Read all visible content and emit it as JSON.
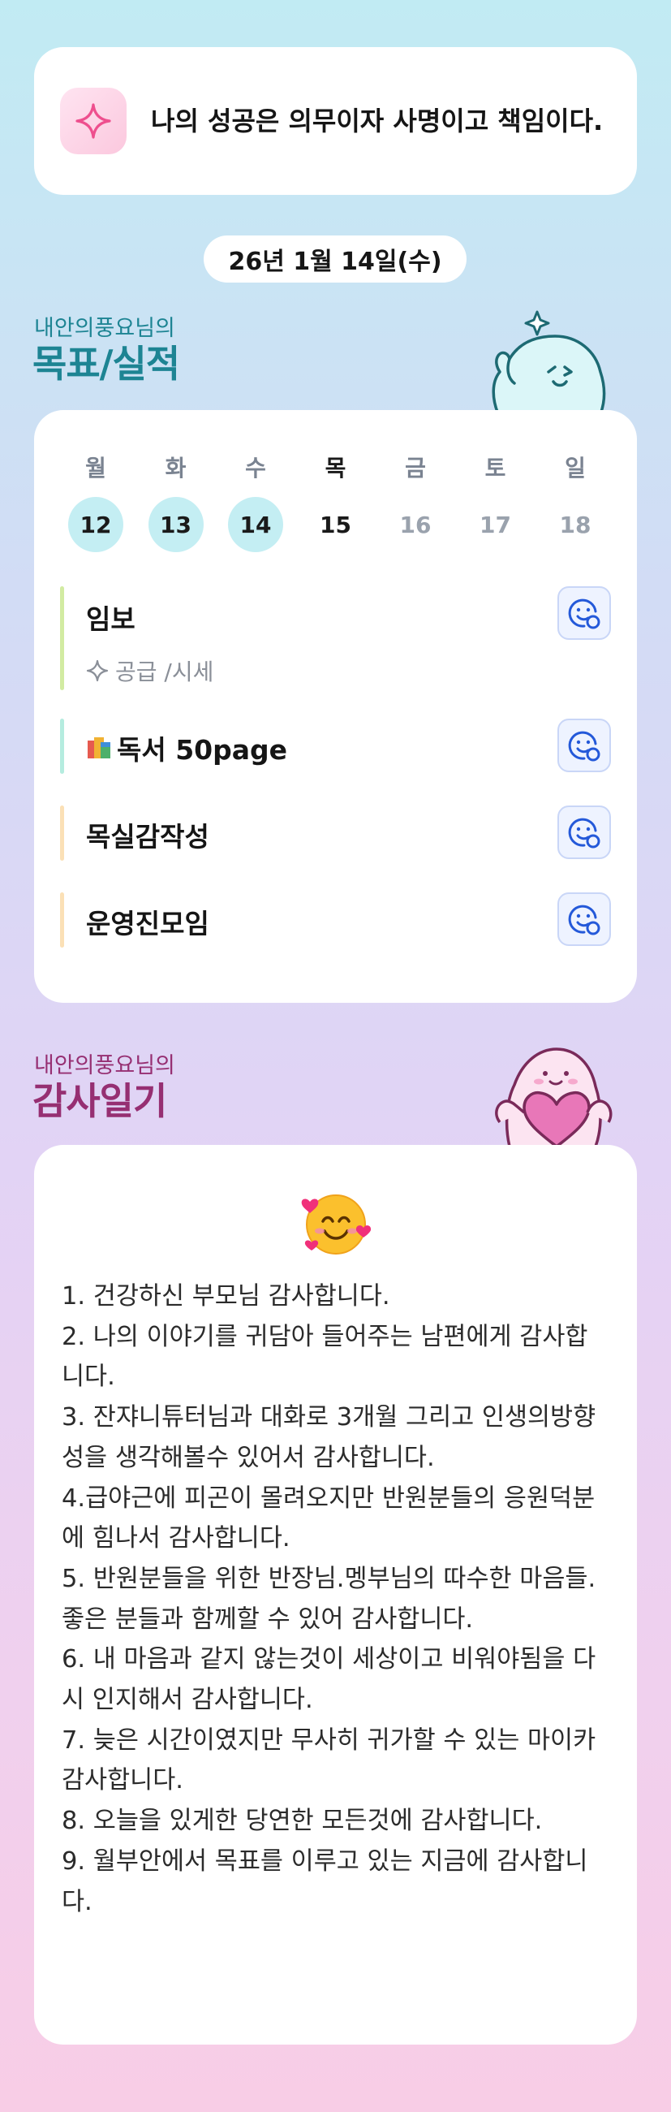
{
  "motto": {
    "text": "나의 성공은 의무이자 사명이고 책임이다.",
    "icon": "sparkle-icon"
  },
  "date": "26년 1월 14일(수)",
  "goals_section": {
    "subtitle": "내안의풍요님의",
    "title": "목표/실적",
    "accent": "#1d8493",
    "week": {
      "days": [
        "월",
        "화",
        "수",
        "목",
        "금",
        "토",
        "일"
      ],
      "dates": [
        "12",
        "13",
        "14",
        "15",
        "16",
        "17",
        "18"
      ]
    },
    "items": [
      {
        "title": "임보",
        "subtitle": "공급 /시세",
        "bar_color": "#d2eba2"
      },
      {
        "title": "독서 50page",
        "bar_color": "#b5ecdf"
      },
      {
        "title": "목실감작성",
        "bar_color": "#fbe0b6"
      },
      {
        "title": "운영진모임",
        "bar_color": "#fbe0b6"
      }
    ]
  },
  "gratitude_section": {
    "subtitle": "내안의풍요님의",
    "title": "감사일기",
    "accent": "#962f72",
    "emoji": "smiling-face-with-hearts-icon",
    "text": "1. 건강하신 부모님 감사합니다.\n2. 나의 이야기를 귀담아 들어주는 남편에게 감사합니다.\n3. 잔쟈니튜터님과 대화로 3개월 그리고 인생의방향성을 생각해볼수 있어서 감사합니다.\n4.급야근에 피곤이 몰려오지만 반원분들의 응원덕분에 힘나서 감사합니다.\n5. 반원분들을 위한 반장님.멩부님의 따수한 마음들. 좋은 분들과 함께할 수 있어 감사합니다.\n6. 내 마음과 같지 않는것이 세상이고 비워야됨을 다시 인지해서 감사합니다.\n7. 늦은 시간이였지만 무사히 귀가할 수 있는 마이카 감사합니다.\n8. 오늘을 있게한 당연한 모든것에 감사합니다.\n9. 월부안에서 목표를 이루고 있는 지금에 감사합니다."
  }
}
